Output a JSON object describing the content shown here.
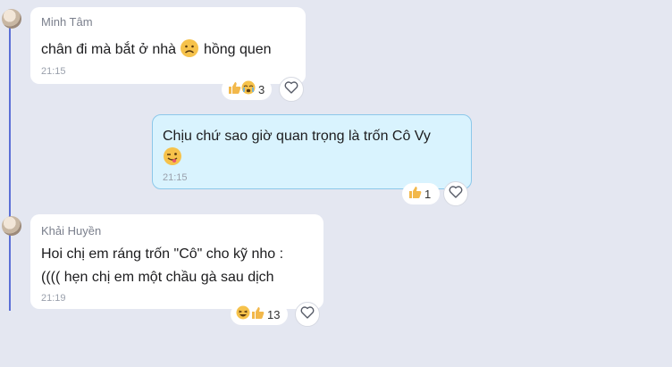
{
  "messages": [
    {
      "sender": "Minh Tâm",
      "text": "chân đi mà bắt ở nhà",
      "text_suffix": "hồng quen",
      "time": "21:15",
      "reaction_count": "3"
    },
    {
      "sender": "",
      "line1": "Chịu chứ sao giờ quan trọng là trốn Cô Vy",
      "time": "21:15",
      "reaction_count": "1"
    },
    {
      "sender": "Khải Huyền",
      "line1": "Hoi chị em ráng trốn \"Cô\" cho kỹ nho :",
      "line2": "(((( hẹn chị em một chầu gà sau dịch",
      "time": "21:19",
      "reaction_count": "13"
    }
  ],
  "icons": {
    "reaction": "thumbs-up",
    "react_button": "heart-outline"
  },
  "colors": {
    "background": "#e4e7f1",
    "own_bubble": "#d9f3fe",
    "own_bubble_border": "#8cc8ea",
    "thread_line": "#5b6fd6"
  }
}
